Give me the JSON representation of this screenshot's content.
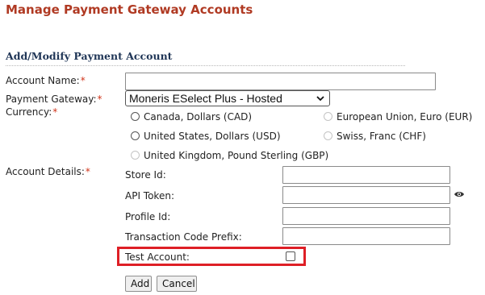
{
  "page": {
    "title": "Manage Payment Gateway Accounts"
  },
  "section": {
    "title": "Add/Modify Payment Account"
  },
  "form": {
    "required_mark": "*",
    "account_name": {
      "label": "Account Name:",
      "value": ""
    },
    "payment_gateway": {
      "label": "Payment Gateway:",
      "selected": "Moneris ESelect Plus - Hosted"
    },
    "currency": {
      "label": "Currency:",
      "options": [
        {
          "label": "Canada, Dollars (CAD)",
          "enabled": true,
          "checked": false
        },
        {
          "label": "European Union, Euro (EUR)",
          "enabled": false,
          "checked": false
        },
        {
          "label": "United States, Dollars (USD)",
          "enabled": true,
          "checked": false
        },
        {
          "label": "Swiss, Franc (CHF)",
          "enabled": false,
          "checked": false
        },
        {
          "label": "United Kingdom, Pound Sterling (GBP)",
          "enabled": false,
          "checked": false
        }
      ]
    },
    "account_details": {
      "label": "Account Details:",
      "store_id": {
        "label": "Store Id:",
        "value": ""
      },
      "api_token": {
        "label": "API Token:",
        "value": "",
        "toggle_icon": "eye-icon"
      },
      "profile_id": {
        "label": "Profile Id:",
        "value": ""
      },
      "transaction_code_prefix": {
        "label": "Transaction Code Prefix:",
        "value": ""
      },
      "test_account": {
        "label": "Test Account:",
        "checked": false
      }
    }
  },
  "buttons": {
    "add": "Add",
    "cancel": "Cancel"
  },
  "colors": {
    "title": "#b03a23",
    "section_title": "#1f3556",
    "required": "#d0341a",
    "highlight_border": "#de1f26"
  }
}
